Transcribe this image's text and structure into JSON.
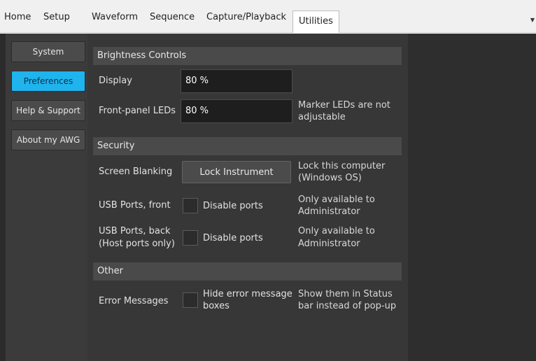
{
  "menu": {
    "tabs": [
      "Home",
      "Setup",
      "Waveform",
      "Sequence",
      "Capture/Playback",
      "Utilities"
    ],
    "active_tab": "Utilities",
    "overflow_icon": "chevron-down-icon"
  },
  "sidebar": {
    "items": [
      "System",
      "Preferences",
      "Help & Support",
      "About my AWG"
    ],
    "selected": "Preferences",
    "accent_color": "#1fb4ee"
  },
  "brightness": {
    "section_title": "Brightness Controls",
    "display_label": "Display",
    "display_value": "80 %",
    "leds_label": "Front-panel LEDs",
    "leds_value": "80 %",
    "leds_note_line1": "Marker LEDs are not",
    "leds_note_line2": "adjustable"
  },
  "security": {
    "section_title": "Security",
    "blanking_label": "Screen Blanking",
    "lock_button": "Lock Instrument",
    "lock_note_line1": "Lock this computer",
    "lock_note_line2": "(Windows OS)",
    "usb_front_label": "USB Ports, front",
    "usb_front_checkbox": "Disable ports",
    "usb_front_checked": false,
    "usb_front_note_line1": "Only available to",
    "usb_front_note_line2": "Administrator",
    "usb_back_label_line1": "USB Ports, back",
    "usb_back_label_line2": "(Host ports only)",
    "usb_back_checkbox": "Disable ports",
    "usb_back_checked": false,
    "usb_back_note_line1": "Only available to",
    "usb_back_note_line2": "Administrator"
  },
  "other": {
    "section_title": "Other",
    "errors_label": "Error Messages",
    "errors_checkbox_line1": "Hide error message",
    "errors_checkbox_line2": "boxes",
    "errors_checked": false,
    "errors_note_line1": "Show them in Status",
    "errors_note_line2": "bar instead of pop-up"
  }
}
